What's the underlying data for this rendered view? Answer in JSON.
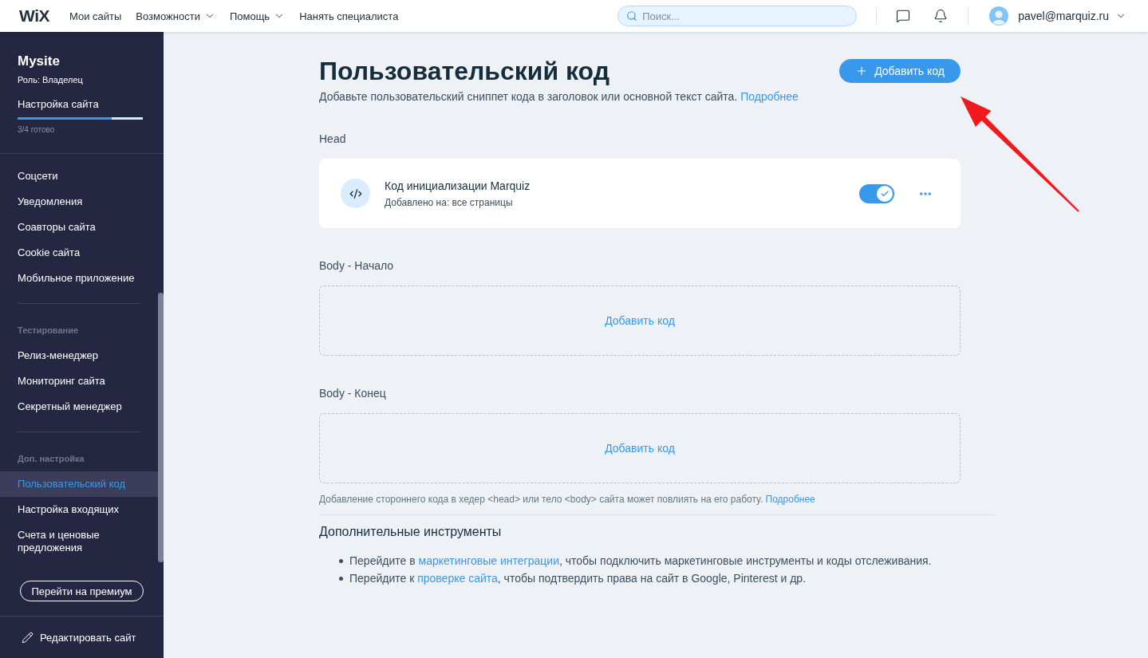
{
  "topbar": {
    "logo": "WiX",
    "nav": [
      {
        "label": "Мои сайты",
        "dropdown": false
      },
      {
        "label": "Возможности",
        "dropdown": true
      },
      {
        "label": "Помощь",
        "dropdown": true
      },
      {
        "label": "Нанять специалиста",
        "dropdown": false
      }
    ],
    "search": {
      "placeholder": "Поиск..."
    },
    "account": {
      "email": "pavel@marquiz.ru"
    }
  },
  "sidebar": {
    "site_name": "Mysite",
    "role": "Роль: Владелец",
    "setup": {
      "title": "Настройка сайта",
      "level": 0.75,
      "status": "3/4 готово"
    },
    "groups": [
      {
        "items": [
          {
            "label": "Соцсети",
            "selected": false
          },
          {
            "label": "Уведомления",
            "selected": false
          },
          {
            "label": "Соавторы сайта",
            "selected": false
          },
          {
            "label": "Cookie сайта",
            "selected": false
          },
          {
            "label": "Мобильное приложение",
            "selected": false
          }
        ]
      },
      {
        "title": "Тестирование",
        "items": [
          {
            "label": "Релиз-менеджер",
            "selected": false
          },
          {
            "label": "Мониторинг сайта",
            "selected": false
          },
          {
            "label": "Секретный менеджер",
            "selected": false
          }
        ]
      },
      {
        "title": "Доп. настройка",
        "items": [
          {
            "label": "Пользовательский код",
            "selected": true
          },
          {
            "label": "Настройка входящих",
            "selected": false
          },
          {
            "label": "Счета и ценовые предложения",
            "selected": false
          }
        ]
      }
    ],
    "premium_button": "Перейти на премиум",
    "edit_button": "Редактировать сайт"
  },
  "main": {
    "title": "Пользовательский код",
    "description": "Добавьте пользовательский сниппет кода в заголовок или основной текст сайта.",
    "description_link": "Подробнее",
    "add_button": "Добавить код",
    "sections": [
      {
        "kind": "snippets",
        "title": "Head",
        "snippets": [
          {
            "name": "Код инициализации Marquiz",
            "placement": "Добавлено на: все страницы",
            "on": true
          }
        ]
      },
      {
        "kind": "empty",
        "title": "Body - Начало",
        "action": "Добавить код"
      },
      {
        "kind": "empty",
        "title": "Body - Конец",
        "action": "Добавить код"
      }
    ],
    "note": {
      "text": "Добавление стороннего кода в хедер <head> или тело <body> сайта может повлиять на его работу.",
      "link": "Подробнее"
    },
    "tools": {
      "title": "Дополнительные инструменты",
      "items": [
        {
          "before": "Перейдите в ",
          "link": "маркетинговые интеграции",
          "after": ", чтобы подключить маркетинговые инструменты и коды отслеживания."
        },
        {
          "before": "Перейдите к ",
          "link": "проверке сайта",
          "after": ", чтобы подтвердить права на сайт в Google, Pinterest и др."
        }
      ]
    }
  }
}
